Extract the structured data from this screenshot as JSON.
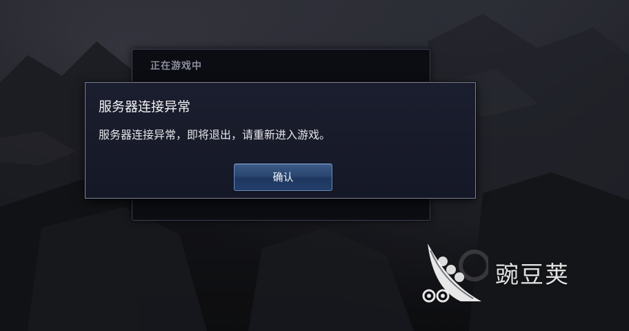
{
  "background_panel": {
    "title": "正在游戏中"
  },
  "dialog": {
    "title": "服务器连接异常",
    "message": "服务器连接异常，即将退出，请重新进入游戏。",
    "confirm_label": "确认"
  },
  "watermark": {
    "text": "豌豆荚",
    "icon": "peapod-logo-icon"
  },
  "colors": {
    "dialog_bg": "#171a29",
    "dialog_border": "#7e8293",
    "button_blue": "#2a4670"
  }
}
